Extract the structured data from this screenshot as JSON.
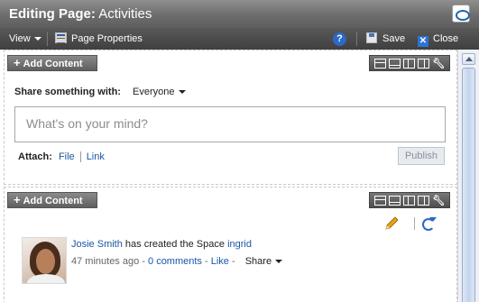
{
  "header": {
    "title_prefix": "Editing Page:",
    "title_page": "Activities"
  },
  "toolbar": {
    "view_label": "View",
    "page_properties_label": "Page Properties",
    "help_icon_glyph": "?",
    "save_label": "Save",
    "close_label": "Close"
  },
  "regions": [
    {
      "add_content_label": "Add Content",
      "share_label": "Share something with:",
      "share_value": "Everyone",
      "post_placeholder": "What's on your mind?",
      "attach_label": "Attach:",
      "attach_file": "File",
      "attach_link": "Link",
      "publish_label": "Publish"
    },
    {
      "add_content_label": "Add Content",
      "activity": {
        "user": "Josie Smith",
        "action": "has created the Space",
        "space": "ingrid",
        "time": "47 minutes ago",
        "comments": "0 comments",
        "like": "Like",
        "share": "Share"
      }
    }
  ],
  "icons": {
    "logo": "oracle-logo-icon",
    "page_properties": "page-properties-icon",
    "help": "help-icon",
    "save": "save-icon",
    "close": "close-icon",
    "edit": "pencil-icon",
    "refresh": "refresh-icon"
  },
  "colors": {
    "header_bg": "#6d6d6d",
    "toolbar_bg": "#4a4a4a",
    "link": "#1b56a6",
    "accent_blue": "#2c68c8"
  }
}
